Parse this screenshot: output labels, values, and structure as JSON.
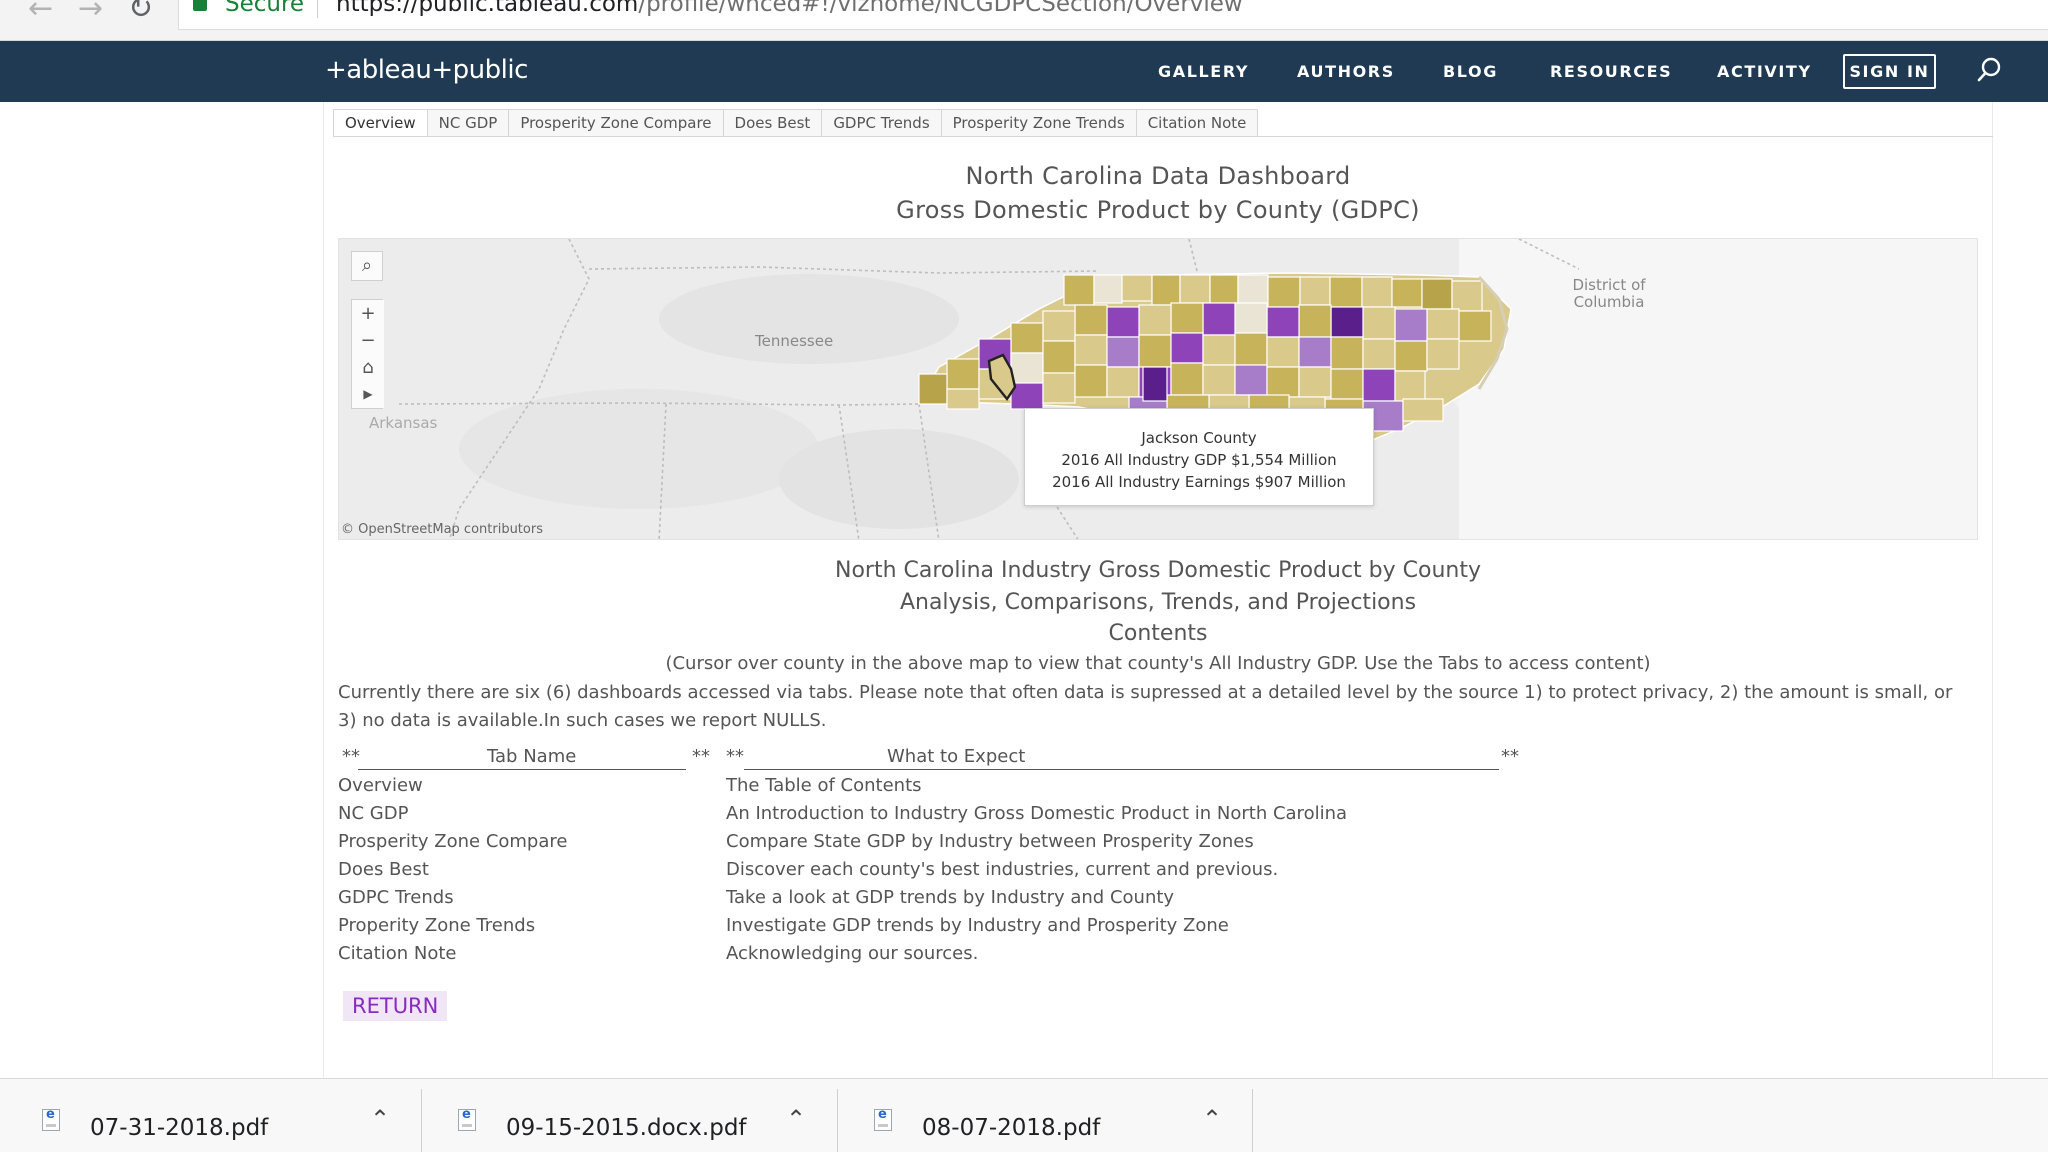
{
  "browser": {
    "secure_label": "Secure",
    "url_domain": "https://public.tableau.com",
    "url_path": "/profile/wnced#!/vizhome/NCGDPCSection/Overview"
  },
  "header": {
    "logo": "+ableau+public",
    "nav": [
      "GALLERY",
      "AUTHORS",
      "BLOG",
      "RESOURCES",
      "ACTIVITY"
    ],
    "sign_in": "SIGN IN"
  },
  "tabs": [
    "Overview",
    "NC GDP",
    "Prosperity Zone Compare",
    "Does Best",
    "GDPC Trends",
    "Prosperity Zone Trends",
    "Citation Note"
  ],
  "dashboard": {
    "title_line1": "North Carolina Data Dashboard",
    "title_line2": "Gross Domestic Product by County (GDPC)"
  },
  "map": {
    "labels": {
      "tennessee": "Tennessee",
      "arkansas": "Arkansas",
      "dc": "District of Columbia"
    },
    "credit": "© OpenStreetMap contributors",
    "tooltip": {
      "county": "Jackson County",
      "gdp_line": "2016 All Industry GDP $1,554 Million",
      "earnings_line": "2016 All Industry Earnings $907 Million"
    },
    "colors": {
      "low": "#d9c98a",
      "mid": "#c7b35a",
      "high": "#8e44b8",
      "highest": "#5a1f8a",
      "light": "#e9e4d3"
    }
  },
  "contents": {
    "heading1": "North Carolina Industry Gross Domestic Product by County",
    "heading2": "Analysis, Comparisons, Trends, and Projections",
    "heading3": "Contents",
    "hint": "(Cursor over county in the above map to view that county's All Industry GDP. Use the Tabs to access content)",
    "para_line1": "Currently there are six (6) dashboards accessed via tabs. Please note that often data is supressed at a detailed level by the source 1) to protect privacy, 2) the amount is small, or",
    "para_line2": "3) no data is available.In such cases we report NULLS.",
    "table_head_name": "Tab Name",
    "table_head_desc": "What to Expect",
    "stars": "**",
    "rows": [
      {
        "name": "Overview",
        "desc": "The Table of Contents"
      },
      {
        "name": "NC GDP",
        "desc": "An Introduction to Industry Gross Domestic Product in North Carolina"
      },
      {
        "name": "Prosperity Zone Compare",
        "desc": "Compare State GDP by Industry between Prosperity Zones"
      },
      {
        "name": "Does Best",
        "desc": "Discover each county's best industries, current and previous."
      },
      {
        "name": "GDPC Trends",
        "desc": "Take a look at GDP trends by Industry and County"
      },
      {
        "name": "Properity Zone Trends",
        "desc": "Investigate GDP trends by Industry and Prosperity Zone"
      },
      {
        "name": "Citation Note",
        "desc": "Acknowledging our sources."
      }
    ],
    "return_label": "RETURN"
  },
  "downloads": [
    {
      "name": "07-31-2018.pdf"
    },
    {
      "name": "09-15-2015.docx.pdf"
    },
    {
      "name": "08-07-2018.pdf"
    }
  ]
}
